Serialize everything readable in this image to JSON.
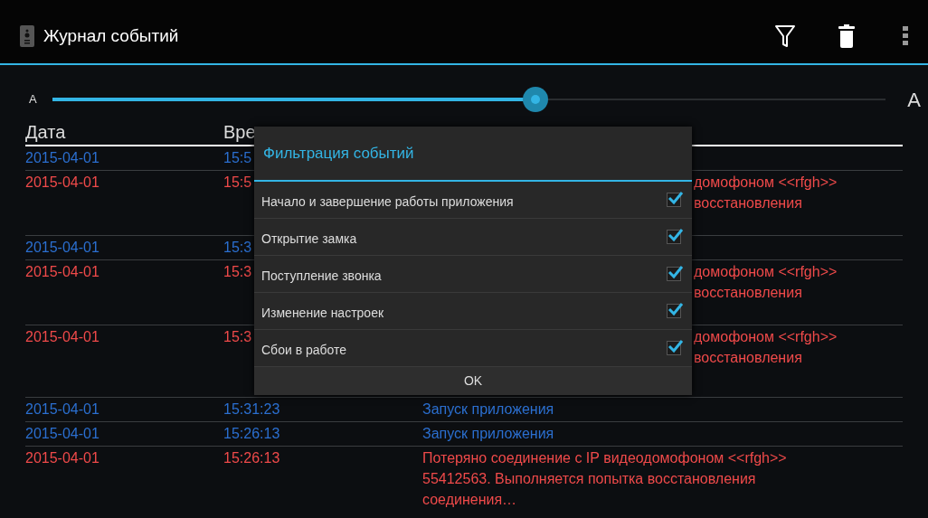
{
  "action_bar": {
    "title": "Журнал событий"
  },
  "font_slider": {
    "min_label": "A",
    "max_label": "A",
    "level": 0.58
  },
  "table": {
    "columns": [
      "Дата",
      "Вре"
    ],
    "rows": [
      {
        "color": "#2b6fd0",
        "date": "2015-04-01",
        "time": "15:5"
      },
      {
        "color": "#f04a4a",
        "date": "2015-04-01",
        "time": "15:5",
        "description_fragment": [
          "домофоном <<rfgh>>",
          "восстановления"
        ]
      },
      {
        "color": "#2b6fd0",
        "date": "2015-04-01",
        "time": "15:3"
      },
      {
        "color": "#f04a4a",
        "date": "2015-04-01",
        "time": "15:3",
        "description_fragment": [
          "домофоном <<rfgh>>",
          "восстановления"
        ]
      },
      {
        "color": "#f04a4a",
        "date": "2015-04-01",
        "time": "15:3",
        "description_fragment": [
          "домофоном <<rfgh>>",
          "восстановления"
        ]
      },
      {
        "color": "#2b6fd0",
        "date": "2015-04-01",
        "time": "15:31:23",
        "description": [
          "Запуск приложения"
        ]
      },
      {
        "color": "#2b6fd0",
        "date": "2015-04-01",
        "time": "15:26:13",
        "description": [
          "Запуск приложения"
        ]
      },
      {
        "color": "#f04a4a",
        "date": "2015-04-01",
        "time": "15:26:13",
        "description": [
          "Потеряно соединение с IP видеодомофоном <<rfgh>>",
          "55412563. Выполняется попытка восстановления",
          "соединения…"
        ]
      }
    ]
  },
  "dialog": {
    "title": "Фильтрация событий",
    "options": [
      {
        "label": "Начало и завершение работы приложения",
        "checked": true
      },
      {
        "label": "Открытие замка",
        "checked": true
      },
      {
        "label": "Поступление звонка",
        "checked": true
      },
      {
        "label": "Изменение настроек",
        "checked": true
      },
      {
        "label": "Сбои в работе",
        "checked": true
      }
    ],
    "ok_button": "OK"
  }
}
